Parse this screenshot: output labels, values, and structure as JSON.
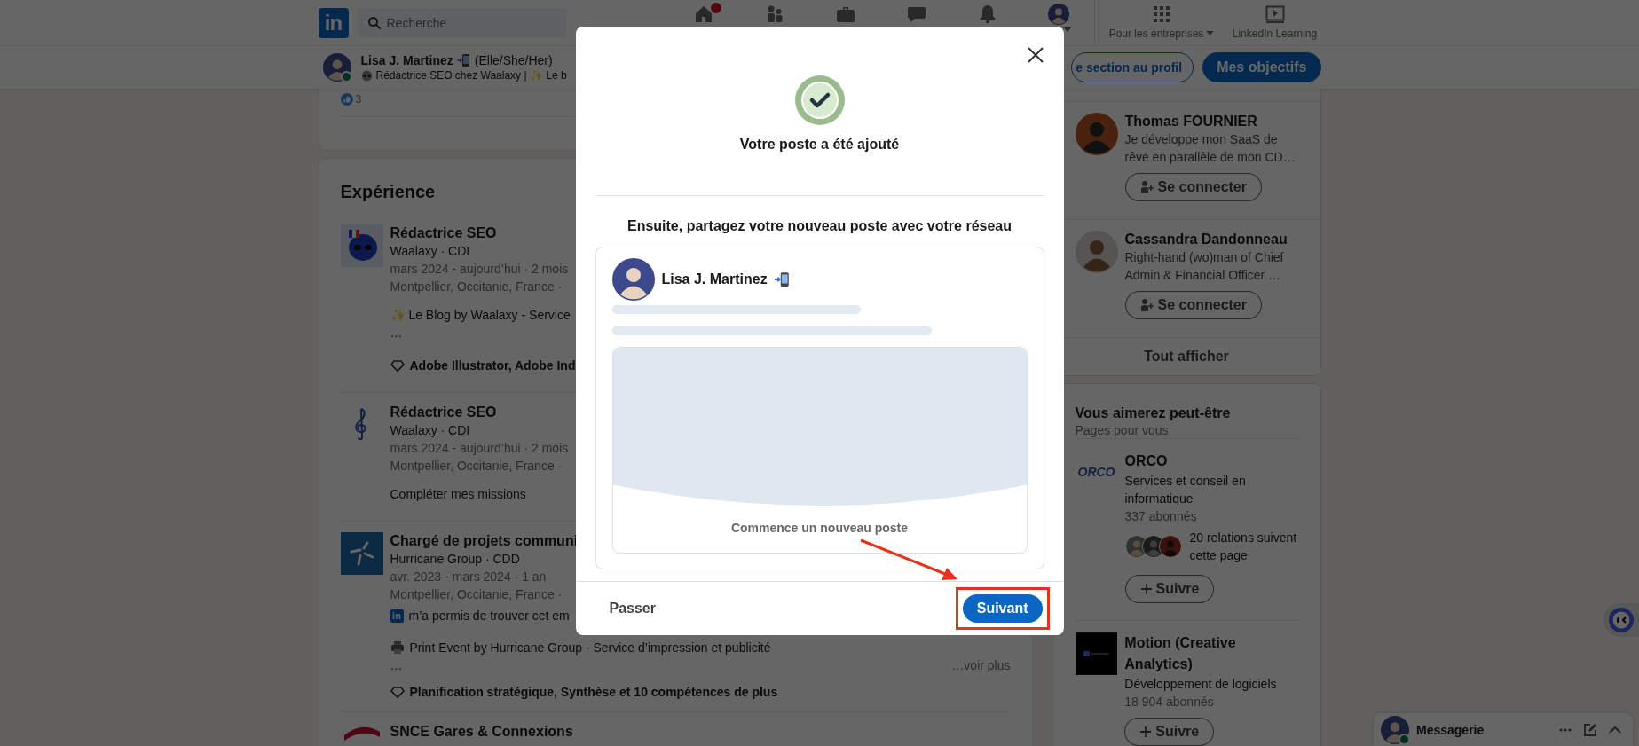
{
  "nav": {
    "logo": "in",
    "search": {
      "placeholder": "Recherche"
    },
    "items": [
      {
        "kind": "home",
        "notification": true
      },
      {
        "kind": "network",
        "notification": false
      },
      {
        "kind": "jobs",
        "notification": false
      },
      {
        "kind": "messaging",
        "notification": false
      },
      {
        "kind": "notifications",
        "notification": false
      },
      {
        "kind": "me",
        "notification": false
      }
    ],
    "extras": [
      {
        "kind": "grid",
        "label": "Pour les entreprises"
      },
      {
        "kind": "learning",
        "label": "LinkedIn Learning"
      }
    ]
  },
  "profile_bar": {
    "name": "Lisa J. Martinez",
    "pronouns": "(Elle/She/Her)",
    "headline": "Rédactrice SEO chez Waalaxy | ✨ Le b",
    "online": true,
    "buttons": [
      {
        "label": "e section au profil",
        "kind": "outline"
      },
      {
        "label": "Mes objectifs",
        "kind": "primary"
      }
    ]
  },
  "reactions": {
    "count": "3"
  },
  "experience": {
    "title": "Expérience",
    "items": [
      {
        "kind": "alien",
        "title": "Rédactrice SEO",
        "subtitle": "Waalaxy · CDI",
        "dates": "mars 2024 - aujourd’hui · 2 mois",
        "location": "Montpellier, Occitanie, France ·",
        "details": [
          {
            "kind": "description",
            "text": "✨ Le Blog by Waalaxy - Service"
          },
          {
            "kind": "ellipsis",
            "text": "…"
          },
          {
            "kind": "skills",
            "text": "Adobe Illustrator, Adobe Ind"
          }
        ]
      },
      {
        "kind": "note",
        "title": "Rédactrice SEO",
        "subtitle": "Waalaxy · CDI",
        "dates": "mars 2024 - aujourd’hui · 2 mois",
        "location": "Montpellier, Occitanie, France ·",
        "details": [
          {
            "kind": "action",
            "text": "Compléter mes missions"
          }
        ]
      },
      {
        "kind": "wind",
        "title": "Chargé de projets communi",
        "subtitle": "Hurricane Group · CDD",
        "dates": "avr. 2023 - mars 2024 · 1 an",
        "location": "Montpellier, Occitanie, France ·",
        "details": [
          {
            "kind": "linkedin",
            "badge": "in",
            "text": "m’a permis de trouver cet em"
          },
          {
            "kind": "printer",
            "text": "Print Event by Hurricane Group - Service d’impression et publicité"
          },
          {
            "kind": "more",
            "text": "…",
            "link": "…voir plus"
          },
          {
            "kind": "skills",
            "text": "Planification stratégique, Synthèse et 10 compétences de plus"
          }
        ]
      },
      {
        "kind": "train",
        "title": "SNCE Gares & Connexions"
      }
    ]
  },
  "sidebar": {
    "people": [
      {
        "name": "Thomas FOURNIER",
        "headline": "Je développe mon SaaS de rêve en parallèle de mon CD…",
        "button": "Se connecter",
        "kind": "dark"
      },
      {
        "name": "Cassandra Dandonneau",
        "headline": "Right-hand (wo)man of Chief Admin & Financial Officer …",
        "button": "Se connecter",
        "kind": "light"
      }
    ],
    "show_all": "Tout afficher",
    "pages": {
      "title": "Vous aimerez peut-être",
      "subtitle": "Pages pour vous",
      "items": [
        {
          "kind": "orco",
          "logo_text": "ORCO",
          "name": "ORCO",
          "description": "Services et conseil en informatique",
          "followers": "337 abonnés",
          "relations": "20 relations suivent cette page",
          "button": "Suivre"
        },
        {
          "kind": "motion",
          "name": "Motion (Creative Analytics)",
          "description": "Développement de logiciels",
          "followers": "18 904 abonnés",
          "button": "Suivre"
        }
      ]
    }
  },
  "modal": {
    "title": "Votre poste a été ajouté",
    "prompt": "Ensuite, partagez votre nouveau poste avec votre réseau",
    "preview": {
      "author": "Lisa J. Martinez",
      "caption": "Commence un nouveau poste"
    },
    "buttons": [
      {
        "label": "Passer",
        "kind": "text",
        "highlighted": false
      },
      {
        "label": "Suivant",
        "kind": "primary",
        "highlighted": true
      }
    ]
  },
  "messaging": {
    "title": "Messagerie",
    "online": true
  }
}
